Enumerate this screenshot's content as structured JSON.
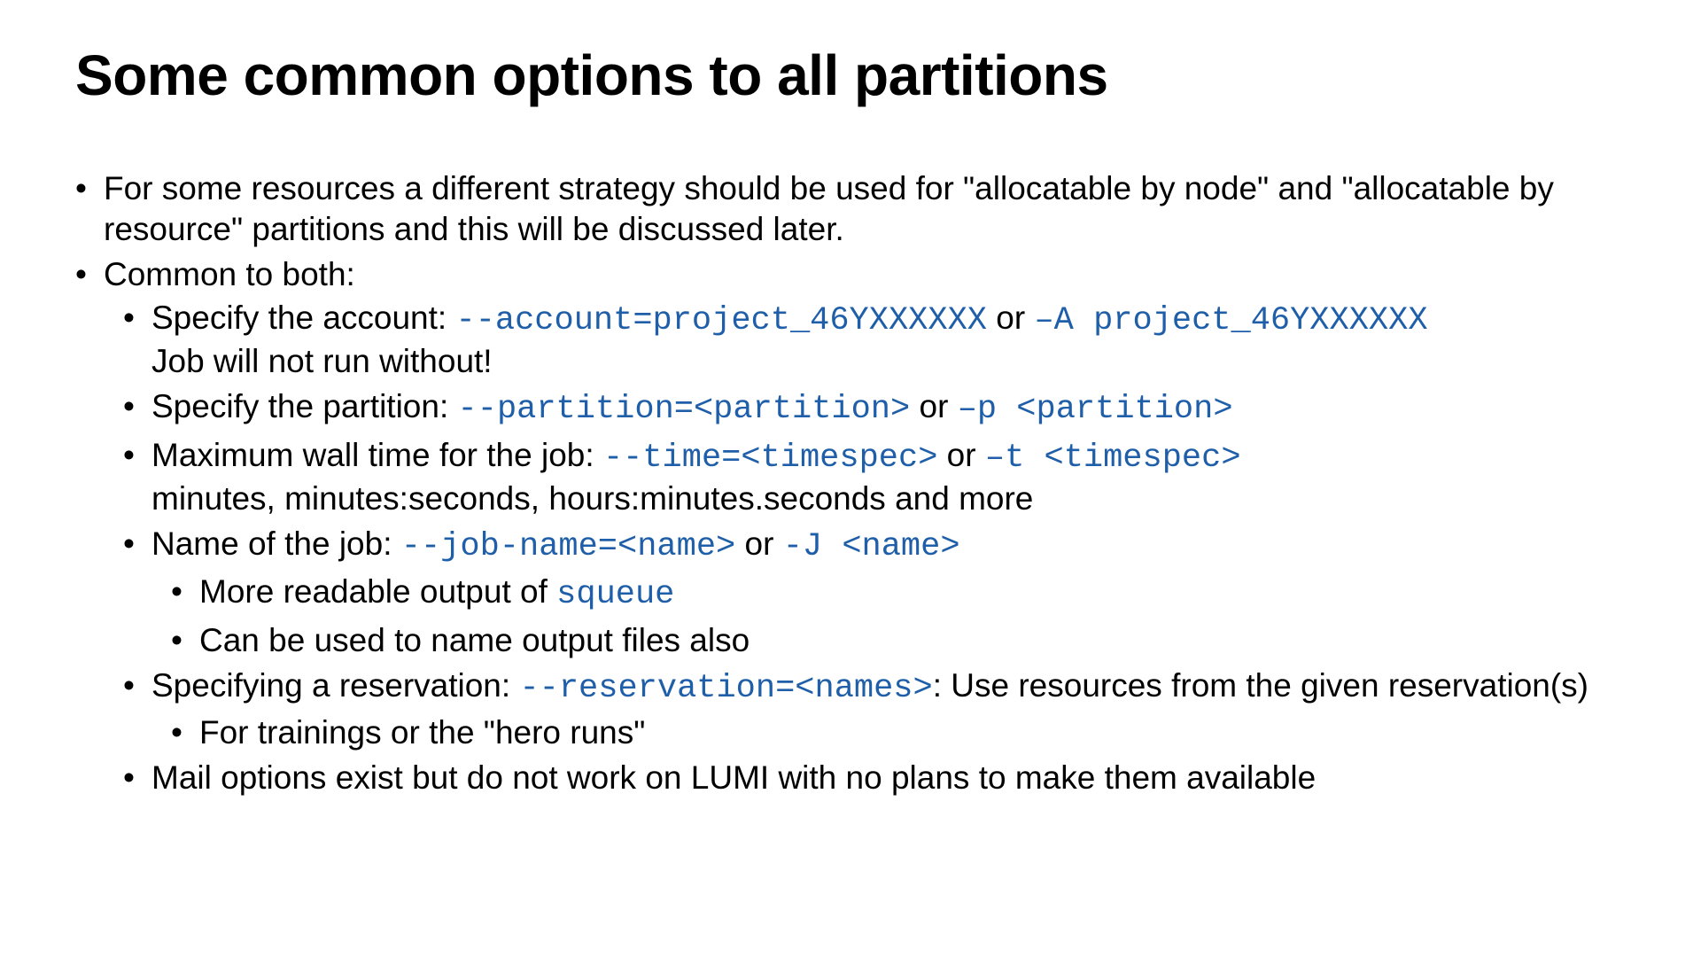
{
  "title": "Some common options to all partitions",
  "b1": "For some resources a different strategy should be used for \"allocatable by node\" and \"allocatable by resource\" partitions and this will be discussed later.",
  "b2": "Common to both:",
  "acct_pre": "Specify the account: ",
  "acct_long": "--account=project_46YXXXXXX",
  "or": " or ",
  "acct_short": "–A project_46YXXXXXX",
  "acct_sub": "Job will not run without!",
  "part_pre": "Specify the partition: ",
  "part_long": "--partition=<partition>",
  "part_short": "–p <partition>",
  "time_pre": "Maximum wall time for the job: ",
  "time_long": "--time=<timespec>",
  "time_short": "–t <timespec>",
  "time_sub": "minutes, minutes:seconds, hours:minutes.seconds and more",
  "name_pre": "Name of the job: ",
  "name_long": "--job-name=<name>",
  "name_short": "-J <name>",
  "name_sub1a": "More readable output of ",
  "name_sub1b": "squeue",
  "name_sub2": "Can be used to name output files also",
  "res_pre": "Specifying a reservation: ",
  "res_long": "--reservation=<names>",
  "res_post": ": Use resources from the given reservation(s)",
  "res_sub1": "For trainings or the \"hero runs\"",
  "mail": "Mail options exist but do not work on LUMI with no plans to make them available"
}
